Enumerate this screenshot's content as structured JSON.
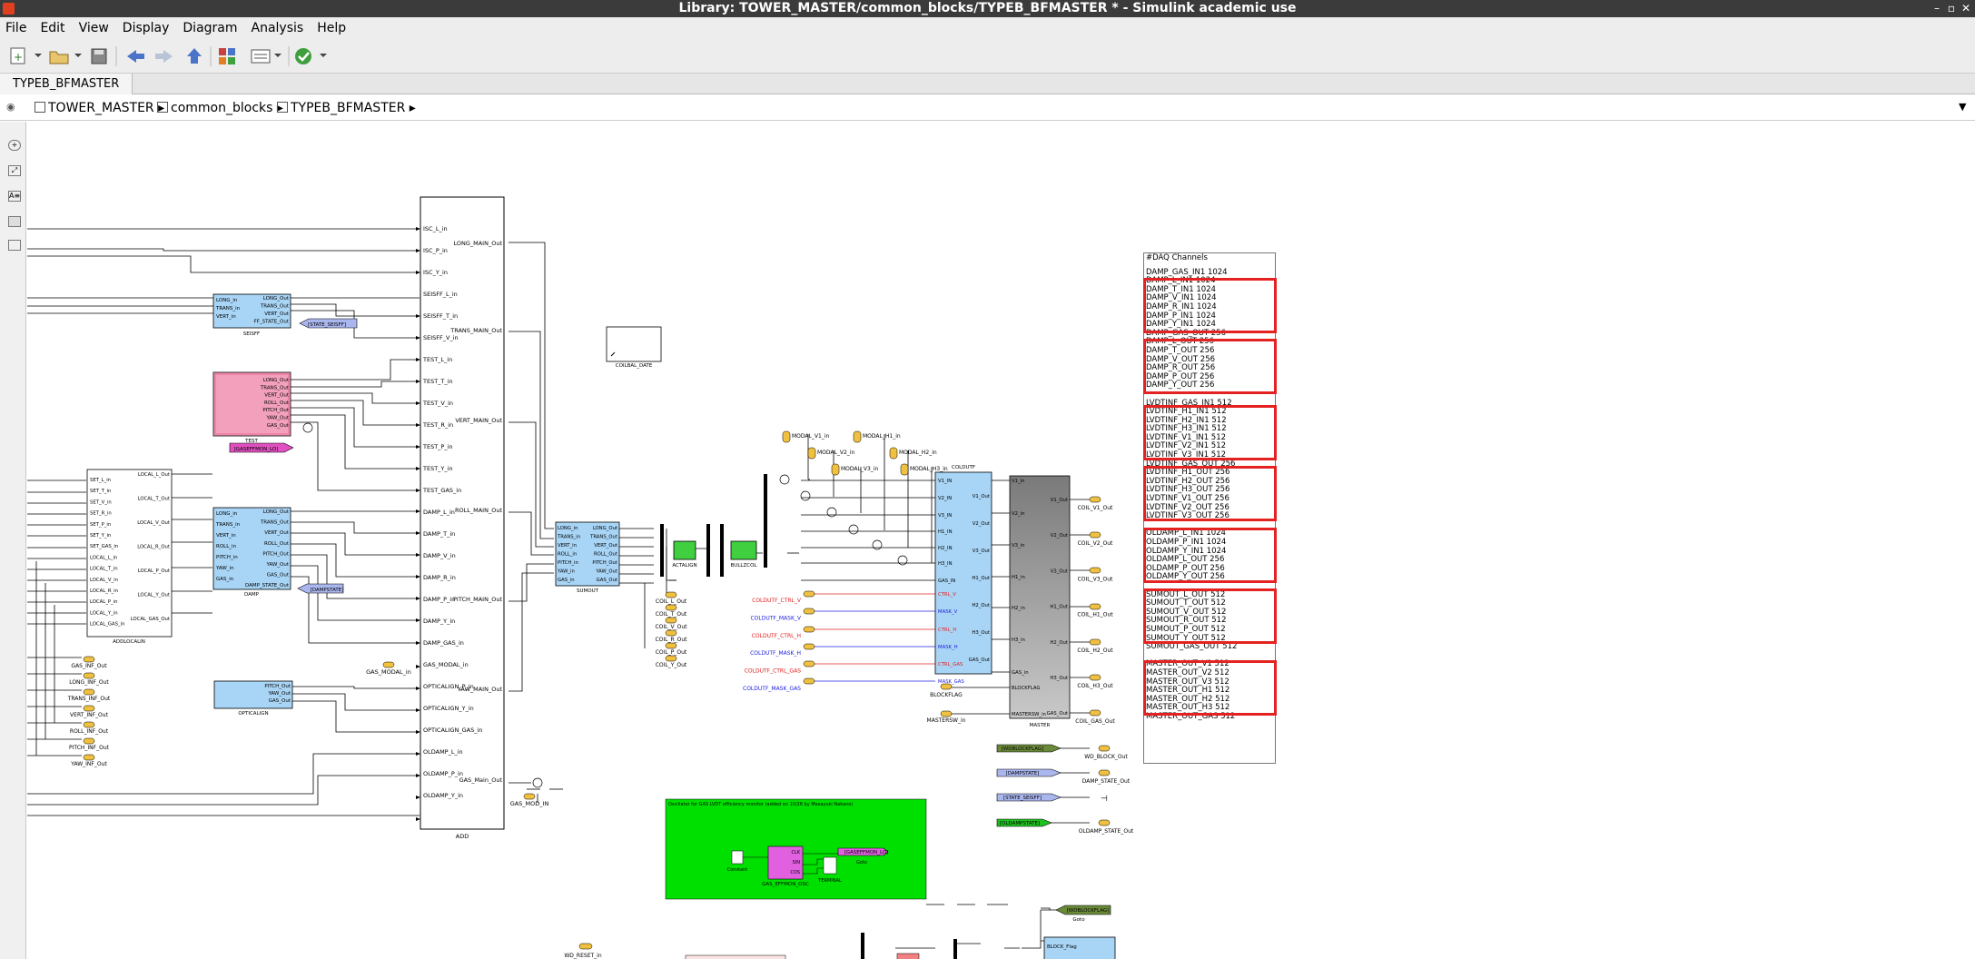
{
  "window": {
    "title": "Library: TOWER_MASTER/common_blocks/TYPEB_BFMASTER * - Simulink academic use",
    "controls": [
      "–",
      "▫",
      "✕"
    ]
  },
  "menu": [
    "File",
    "Edit",
    "View",
    "Display",
    "Diagram",
    "Analysis",
    "Help"
  ],
  "tab": "TYPEB_BFMASTER",
  "breadcrumb": [
    "TOWER_MASTER",
    "common_blocks",
    "TYPEB_BFMASTER"
  ],
  "colors": {
    "accent_red": "#e52222",
    "block_blue": "#a8d4f5",
    "block_pink": "#f2a0bb",
    "block_green": "#3fcf3f",
    "block_gray": "#8a8a8a",
    "dnote_green": "#00e000"
  },
  "daq": {
    "title": "#DAQ Channels",
    "lines": [
      "DAMP_GAS_IN1 1024",
      "DAMP_L_IN1 1024",
      "DAMP_T_IN1 1024",
      "DAMP_V_IN1 1024",
      "DAMP_R_IN1 1024",
      "DAMP_P_IN1 1024",
      "DAMP_Y_IN1 1024",
      "DAMP_GAS_OUT 256",
      "DAMP_L_OUT 256",
      "DAMP_T_OUT 256",
      "DAMP_V_OUT 256",
      "DAMP_R_OUT 256",
      "DAMP_P_OUT 256",
      "DAMP_Y_OUT 256",
      "",
      "LVDTINF_GAS_IN1 512",
      "LVDTINF_H1_IN1 512",
      "LVDTINF_H2_IN1 512",
      "LVDTINF_H3_IN1 512",
      "LVDTINF_V1_IN1 512",
      "LVDTINF_V2_IN1 512",
      "LVDTINF_V3_IN1 512",
      "LVDTINF_GAS_OUT 256",
      "LVDTINF_H1_OUT 256",
      "LVDTINF_H2_OUT 256",
      "LVDTINF_H3_OUT 256",
      "LVDTINF_V1_OUT 256",
      "LVDTINF_V2_OUT 256",
      "LVDTINF_V3_OUT 256",
      "",
      "OLDAMP_L_IN1 1024",
      "OLDAMP_P_IN1 1024",
      "OLDAMP_Y_IN1 1024",
      "OLDAMP_L_OUT 256",
      "OLDAMP_P_OUT 256",
      "OLDAMP_Y_OUT 256",
      "",
      "SUMOUT_L_OUT 512",
      "SUMOUT_T_OUT 512",
      "SUMOUT_V_OUT 512",
      "SUMOUT_R_OUT 512",
      "SUMOUT_P_OUT 512",
      "SUMOUT_Y_OUT 512",
      "SUMOUT_GAS_OUT 512",
      "",
      "MASTER_OUT_V1 512",
      "MASTER_OUT_V2 512",
      "MASTER_OUT_V3 512",
      "MASTER_OUT_H1 512",
      "MASTER_OUT_H2 512",
      "MASTER_OUT_H3 512",
      "MASTER_OUT_GAS 512"
    ]
  },
  "blocks": {
    "add": {
      "name": "ADD",
      "inputs": [
        "ISC_L_in",
        "ISC_P_in",
        "ISC_Y_in",
        "SEISFF_L_in",
        "SEISFF_T_in",
        "SEISFF_V_in",
        "TEST_L_in",
        "TEST_T_in",
        "TEST_V_in",
        "TEST_R_in",
        "TEST_P_in",
        "TEST_Y_in",
        "TEST_GAS_in",
        "DAMP_L_in",
        "DAMP_T_in",
        "DAMP_V_in",
        "DAMP_R_in",
        "DAMP_P_in",
        "DAMP_Y_in",
        "DAMP_GAS_in",
        "GAS_MODAL_in",
        "OPTICALIGN_P_in",
        "OPTICALIGN_Y_in",
        "OPTICALIGN_GAS_in",
        "OLDAMP_L_in",
        "OLDAMP_P_in",
        "OLDAMP_Y_in"
      ],
      "outputs": [
        "LONG_MAIN_Out",
        "TRANS_MAIN_Out",
        "VERT_MAIN_Out",
        "ROLL_MAIN_Out",
        "PITCH_MAIN_Out",
        "YAW_MAIN_Out",
        "GAS_Main_Out"
      ]
    },
    "seisff": {
      "name": "SEISFF",
      "inputs": [
        "LONG_in",
        "TRANS_in",
        "VERT_in"
      ],
      "outputs": [
        "LONG_Out",
        "TRANS_Out",
        "VERT_Out",
        "FF_STATE_Out"
      ]
    },
    "test": {
      "name": "TEST",
      "outputs": [
        "LONG_Out",
        "TRANS_Out",
        "VERT_Out",
        "ROLL_Out",
        "PITCH_Out",
        "YAW_Out",
        "GAS_Out"
      ]
    },
    "addlocalin": {
      "name": "ADDLOCALIN",
      "inputs": [
        "SET_L_in",
        "SET_T_in",
        "SET_V_in",
        "SET_R_in",
        "SET_P_in",
        "SET_Y_in",
        "SET_GAS_in",
        "LOCAL_L_in",
        "LOCAL_T_in",
        "LOCAL_V_in",
        "LOCAL_R_in",
        "LOCAL_P_in",
        "LOCAL_Y_in",
        "LOCAL_GAS_in"
      ],
      "outputs": [
        "LOCAL_L_Out",
        "LOCAL_T_Out",
        "LOCAL_V_Out",
        "LOCAL_R_Out",
        "LOCAL_P_Out",
        "LOCAL_Y_Out",
        "LOCAL_GAS_Out"
      ]
    },
    "damp": {
      "name": "DAMP",
      "inputs": [
        "LONG_in",
        "TRANS_in",
        "VERT_in",
        "ROLL_in",
        "PITCH_in",
        "YAW_in",
        "GAS_in"
      ],
      "outputs": [
        "LONG_Out",
        "TRANS_Out",
        "VERT_Out",
        "ROLL_Out",
        "PITCH_Out",
        "YAW_Out",
        "GAS_Out",
        "DAMP_STATE_Out"
      ]
    },
    "opticalign": {
      "name": "OPTICALIGN",
      "outputs": [
        "PITCH_Out",
        "YAW_Out",
        "GAS_Out"
      ]
    },
    "sumout": {
      "name": "SUMOUT",
      "inputs": [
        "LONG_in",
        "TRANS_in",
        "VERT_in",
        "ROLL_in",
        "PITCH_in",
        "YAW_in",
        "GAS_in"
      ],
      "outputs": [
        "LONG_Out",
        "TRANS_Out",
        "VERT_Out",
        "ROLL_Out",
        "PITCH_Out",
        "YAW_Out",
        "GAS_Out"
      ]
    },
    "coldtf": {
      "name": "COLDUTF",
      "inputs": [
        "V1_IN",
        "V2_IN",
        "V3_IN",
        "H1_IN",
        "H2_IN",
        "H3_IN",
        "GAS_IN",
        "CTRL_V",
        "MASK_V",
        "CTRL_H",
        "MASK_H",
        "CTRL_GAS",
        "MASK_GAS"
      ],
      "outputs": [
        "V1_Out",
        "V2_Out",
        "V3_Out",
        "H1_Out",
        "H2_Out",
        "H3_Out",
        "GAS_Out"
      ]
    },
    "master": {
      "name": "MASTER",
      "inputs": [
        "V1_in",
        "V2_in",
        "V3_in",
        "H1_in",
        "H2_in",
        "H3_in",
        "GAS_in",
        "BLOCKFLAG",
        "MASTERSW_in"
      ],
      "outputs": [
        "V1_Out",
        "V2_Out",
        "V3_Out",
        "H1_Out",
        "H2_Out",
        "H3_Out",
        "GAS_Out"
      ]
    },
    "actalign": "ACTALIGN",
    "bullzcol": "BULLZCOL",
    "coilbal": "COILBAL_DATE",
    "bullzcol_sub": "(subsystem)"
  },
  "tags": {
    "state_seisff": "[STATE_SEISFF]",
    "gasefmon": "[GASEFFMON_LO]",
    "dampstate": "[DAMPSTATE]",
    "wdblockflag": "[WDBLOCKFLAG]",
    "dampstate2": "[DAMPSTATE]",
    "state_seisff2": "[STATE_SEISFF]",
    "oldampstate": "[OLDAMPSTATE]",
    "gasefmon2": "[GASEFFMON_LO]",
    "wdblockflag2": "[WDBLOCKFLAG]"
  },
  "ports": {
    "gas_modal_in": "GAS_MODAL_in",
    "gas_mod_in": "GAS_MOD_IN",
    "out_left": [
      "GAS_INF_Out",
      "LONG_INF_Out",
      "TRANS_INF_Out",
      "VERT_INF_Out",
      "ROLL_INF_Out",
      "PITCH_INF_Out",
      "YAW_INF_Out"
    ],
    "sum_out": [
      "COIL_L_Out",
      "COIL_T_Out",
      "COIL_V_Out",
      "COIL_R_Out",
      "COIL_P_Out",
      "COIL_Y_Out"
    ],
    "modal": [
      "MODAL_V1_in",
      "MODAL_V2_in",
      "MODAL_V3_in",
      "MODAL_H1_in",
      "MODAL_H2_in",
      "MODAL_H3_in"
    ],
    "ctrl": [
      "COLDUTF_CTRL_V",
      "COLDUTF_MASK_V",
      "COLDUTF_CTRL_H",
      "COLDUTF_MASK_H",
      "COLDUTF_CTRL_GAS",
      "COLDUTF_MASK_GAS"
    ],
    "blockflag": "BLOCKFLAG",
    "mastersw": "MASTERSW_in",
    "coil_out": [
      "COIL_V1_Out",
      "COIL_V2_Out",
      "COIL_V3_Out",
      "COIL_H1_Out",
      "COIL_H2_Out",
      "COIL_H3_Out",
      "COIL_GAS_Out"
    ],
    "state_outs": [
      "WD_BLOCK_Out",
      "DAMP_STATE_Out",
      "OLDAMP_STATE_Out"
    ],
    "goto": "Goto",
    "wd_reset": "WD_RESET_in",
    "block_flag": "BLOCK_Flag"
  },
  "green_note": {
    "title": "Oscillator for GAS LVDT efficiency monitor (added on 10/26 by Masayuki Nakano)",
    "constant": "Constant",
    "sub_name": "GAS_EFFMON_OSC",
    "sub_ports": [
      "CLK",
      "SIN",
      "COS"
    ],
    "scope": "TERMINAL",
    "tag": "[GASEFFMON_LO]",
    "goto": "Goto"
  }
}
